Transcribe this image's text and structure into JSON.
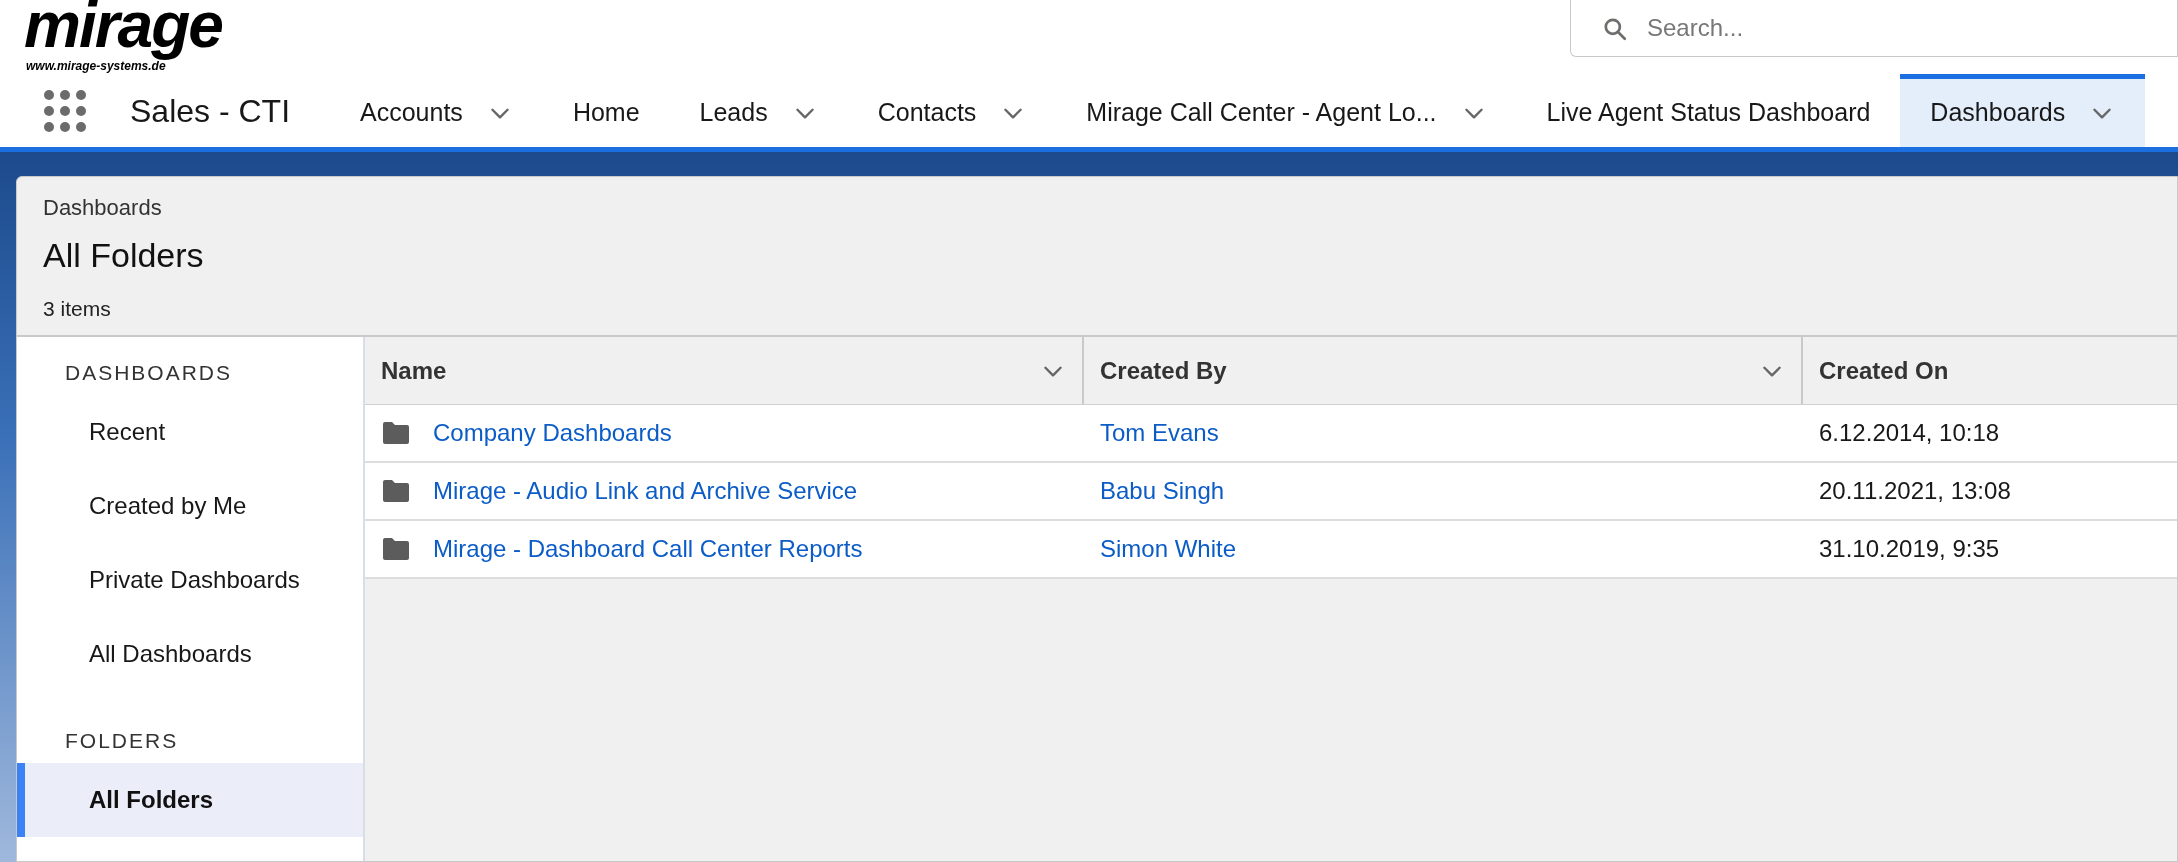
{
  "logo": {
    "wordmark": "mirage",
    "url": "www.mirage-systems.de"
  },
  "search": {
    "placeholder": "Search..."
  },
  "app_name": "Sales - CTI",
  "nav_tabs": [
    {
      "label": "Accounts",
      "has_menu": true,
      "selected": false
    },
    {
      "label": "Home",
      "has_menu": false,
      "selected": false
    },
    {
      "label": "Leads",
      "has_menu": true,
      "selected": false
    },
    {
      "label": "Contacts",
      "has_menu": true,
      "selected": false
    },
    {
      "label": "Mirage Call Center - Agent Lo...",
      "has_menu": true,
      "selected": false
    },
    {
      "label": "Live Agent Status Dashboard",
      "has_menu": false,
      "selected": false
    },
    {
      "label": "Dashboards",
      "has_menu": true,
      "selected": true
    }
  ],
  "header": {
    "breadcrumb": "Dashboards",
    "title": "All Folders",
    "count": "3 items"
  },
  "sidebar": {
    "sections": [
      {
        "heading": "DASHBOARDS",
        "items": [
          {
            "label": "Recent",
            "selected": false
          },
          {
            "label": "Created by Me",
            "selected": false
          },
          {
            "label": "Private Dashboards",
            "selected": false
          },
          {
            "label": "All Dashboards",
            "selected": false
          }
        ]
      },
      {
        "heading": "FOLDERS",
        "items": [
          {
            "label": "All Folders",
            "selected": true
          }
        ]
      }
    ]
  },
  "table": {
    "columns": [
      {
        "label": "Name",
        "has_menu": true
      },
      {
        "label": "Created By",
        "has_menu": true
      },
      {
        "label": "Created On",
        "has_menu": false
      }
    ],
    "rows": [
      {
        "name": "Company Dashboards",
        "created_by": "Tom Evans",
        "created_on": "6.12.2014, 10:18"
      },
      {
        "name": "Mirage - Audio Link and Archive Service",
        "created_by": "Babu Singh",
        "created_on": "20.11.2021, 13:08"
      },
      {
        "name": "Mirage - Dashboard Call Center Reports",
        "created_by": "Simon White",
        "created_on": "31.10.2019, 9:35"
      }
    ]
  }
}
